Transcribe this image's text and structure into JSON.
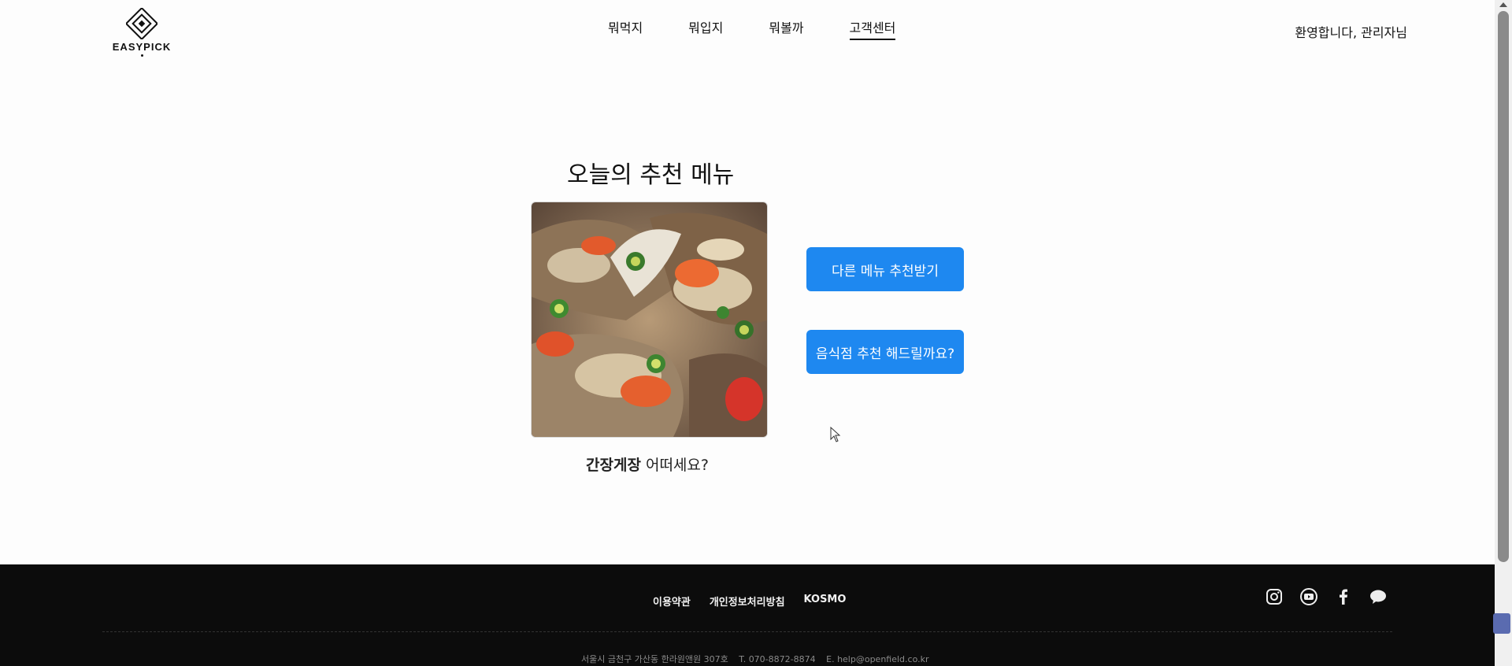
{
  "header": {
    "logo_text": "EASYPICK",
    "nav": [
      {
        "label": "뭐먹지"
      },
      {
        "label": "뭐입지"
      },
      {
        "label": "뭐볼까"
      },
      {
        "label": "고객센터",
        "active": true
      }
    ],
    "welcome": "환영합니다, 관리자님"
  },
  "main": {
    "title": "오늘의 추천 메뉴",
    "menu_name": "간장게장",
    "menu_suffix": " 어떠세요?",
    "btn_other": "다른 메뉴 추천받기",
    "btn_restaurant": "음식점 추천 해드릴까요?"
  },
  "footer": {
    "links": [
      "이용약관",
      "개인정보처리방침",
      "KOSMO"
    ],
    "social_icons": [
      "instagram-icon",
      "youtube-icon",
      "facebook-icon",
      "chat-icon"
    ],
    "address": "서울시 금천구 가산동 한라원앤원 307호",
    "phone": "T. 070-8872-8874",
    "email": "E. help@openfield.co.kr"
  },
  "colors": {
    "accent": "#1e88f0",
    "footer_bg": "#0c0c0c"
  }
}
